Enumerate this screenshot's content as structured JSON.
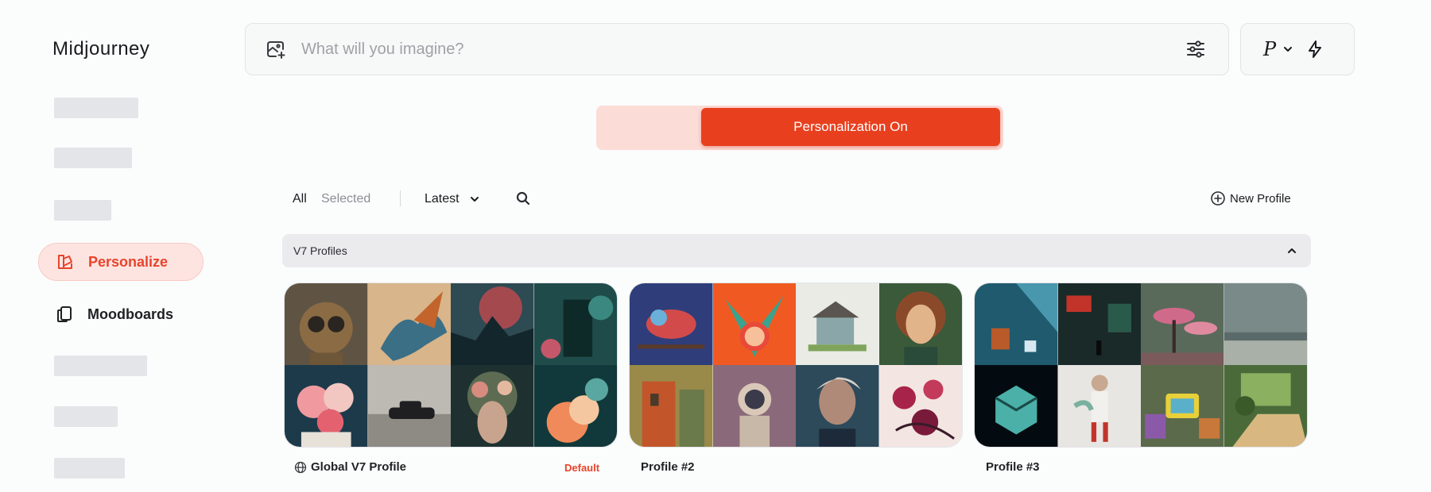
{
  "app": {
    "name": "Midjourney"
  },
  "sidebar": {
    "items": [
      {
        "label": "Personalize",
        "icon": "personalize-icon",
        "active": true
      },
      {
        "label": "Moodboards",
        "icon": "moodboards-icon",
        "active": false
      }
    ]
  },
  "prompt": {
    "placeholder": "What will you imagine?",
    "left_icon": "image-add-icon",
    "right_icon": "sliders-icon"
  },
  "mode": {
    "label": "P",
    "icons": [
      "chevron-down-icon",
      "bolt-icon"
    ]
  },
  "toggle": {
    "on_label": "Personalization On",
    "accent": "#e8401f"
  },
  "filters": {
    "all": "All",
    "selected": "Selected",
    "sort": "Latest",
    "new_profile": "New Profile"
  },
  "section": {
    "title": "V7 Profiles"
  },
  "profiles": [
    {
      "name": "Global V7 Profile",
      "badge": "Default"
    },
    {
      "name": "Profile #2"
    },
    {
      "name": "Profile #3"
    }
  ]
}
